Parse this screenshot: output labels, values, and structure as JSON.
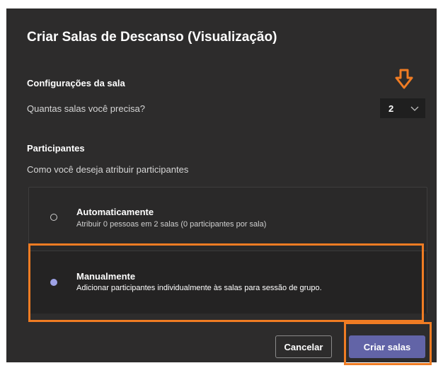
{
  "dialog": {
    "title": "Criar Salas de Descanso (Visualização)"
  },
  "room_settings": {
    "heading": "Configurações da sala",
    "question": "Quantas salas você precisa?",
    "selected_value": "2"
  },
  "participants": {
    "heading": "Participantes",
    "question": "Como você deseja atribuir participantes",
    "options": [
      {
        "title": "Automaticamente",
        "description": "Atribuir 0 pessoas em 2 salas (0 participantes por sala)",
        "selected": false
      },
      {
        "title": "Manualmente",
        "description": "Adicionar participantes individualmente às salas para sessão de grupo.",
        "selected": true
      }
    ]
  },
  "footer": {
    "cancel_label": "Cancelar",
    "create_label": "Criar salas"
  },
  "colors": {
    "dialog_bg": "#2d2c2c",
    "accent": "#6264a7",
    "radio_selected": "#9ea2e6",
    "annotation": "#f07c23"
  },
  "icons": {
    "annotation_arrow": "arrow-down-icon",
    "select_chevron": "chevron-down-icon"
  }
}
